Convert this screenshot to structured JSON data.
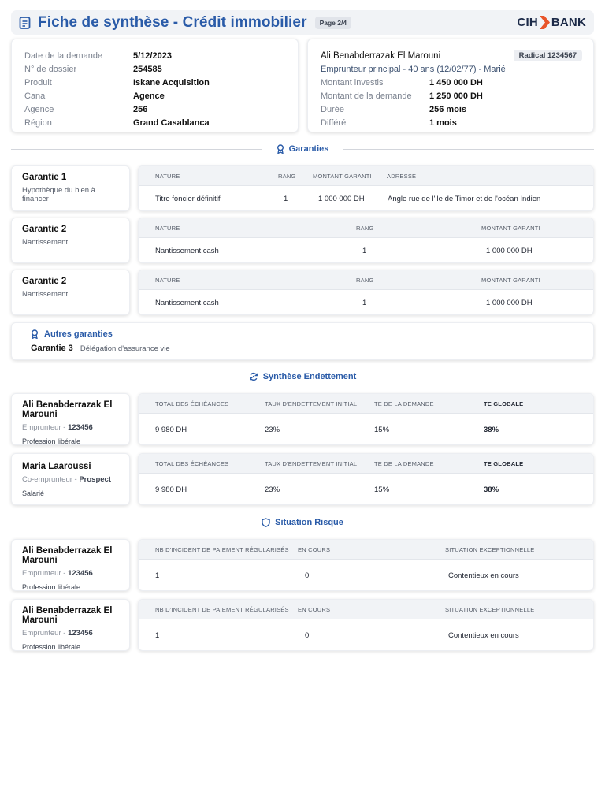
{
  "header": {
    "title": "Fiche de synthèse - Crédit immobilier",
    "page": "Page 2/4",
    "logo_left": "CIH",
    "logo_right": "BANK",
    "brand_color": "#2a5ba8",
    "logo_accent": "#e8542a"
  },
  "dossier": [
    {
      "label": "Date de la demande",
      "value": "5/12/2023"
    },
    {
      "label": "N° de dossier",
      "value": "254585"
    },
    {
      "label": "Produit",
      "value": "Iskane Acquisition"
    },
    {
      "label": "Canal",
      "value": "Agence"
    },
    {
      "label": "Agence",
      "value": "256"
    },
    {
      "label": "Région",
      "value": "Grand Casablanca"
    }
  ],
  "client": {
    "name": "Ali Benabderrazak El Marouni",
    "radical": "Radical 1234567",
    "subtitle": "Emprunteur principal - 40 ans (12/02/77) - Marié",
    "rows": [
      {
        "label": "Montant investis",
        "value": "1 450 000 DH"
      },
      {
        "label": "Montant de la demande",
        "value": "1 250 000 DH"
      },
      {
        "label": "Durée",
        "value": "256 mois"
      },
      {
        "label": "Différé",
        "value": "1 mois"
      }
    ]
  },
  "sections": {
    "garanties": "Garanties",
    "endettement": "Synthèse Endettement",
    "risque": "Situation Risque"
  },
  "garanties": [
    {
      "title": "Garantie 1",
      "subtitle": "Hypothèque du bien à financer",
      "headers": [
        "NATURE",
        "RANG",
        "MONTANT GARANTI",
        "ADRESSE"
      ],
      "values": [
        "Titre foncier définitif",
        "1",
        "1 000 000 DH",
        "Angle rue de l'ile de Timor et de l'océan Indien"
      ]
    },
    {
      "title": "Garantie 2",
      "subtitle": "Nantissement",
      "headers": [
        "NATURE",
        "RANG",
        "MONTANT GARANTI"
      ],
      "values": [
        "Nantissement cash",
        "1",
        "1 000 000 DH"
      ]
    },
    {
      "title": "Garantie 2",
      "subtitle": "Nantissement",
      "headers": [
        "NATURE",
        "RANG",
        "MONTANT GARANTI"
      ],
      "values": [
        "Nantissement cash",
        "1",
        "1 000 000 DH"
      ]
    }
  ],
  "autres_garanties": {
    "title": "Autres garanties",
    "label": "Garantie 3",
    "description": "Délégation d'assurance vie"
  },
  "endettement": [
    {
      "name": "Ali Benabderrazak El Marouni",
      "role": "Emprunteur",
      "role_value": "123456",
      "profession": "Profession libérale",
      "headers": [
        "TOTAL DES ÉCHÉANCES",
        "TAUX D'ENDETTEMENT INITIAL",
        "TE DE LA DEMANDE",
        "TE GLOBALE"
      ],
      "values": [
        "9 980 DH",
        "23%",
        "15%",
        "38%"
      ]
    },
    {
      "name": "Maria Laaroussi",
      "role": "Co-emprunteur",
      "role_value": "Prospect",
      "profession": "Salarié",
      "headers": [
        "TOTAL DES ÉCHÉANCES",
        "TAUX D'ENDETTEMENT INITIAL",
        "TE DE LA DEMANDE",
        "TE GLOBALE"
      ],
      "values": [
        "9 980 DH",
        "23%",
        "15%",
        "38%"
      ]
    }
  ],
  "risque": [
    {
      "name": "Ali Benabderrazak El Marouni",
      "role": "Emprunteur",
      "role_value": "123456",
      "profession": "Profession libérale",
      "headers": [
        "NB D'INCIDENT DE PAIEMENT RÉGULARISÉS",
        "EN COURS",
        "SITUATION EXCEPTIONNELLE"
      ],
      "values": [
        "1",
        "0",
        "Contentieux en cours"
      ]
    },
    {
      "name": "Ali Benabderrazak El Marouni",
      "role": "Emprunteur",
      "role_value": "123456",
      "profession": "Profession libérale",
      "headers": [
        "NB D'INCIDENT DE PAIEMENT RÉGULARISÉS",
        "EN COURS",
        "SITUATION EXCEPTIONNELLE"
      ],
      "values": [
        "1",
        "0",
        "Contentieux en cours"
      ]
    }
  ]
}
